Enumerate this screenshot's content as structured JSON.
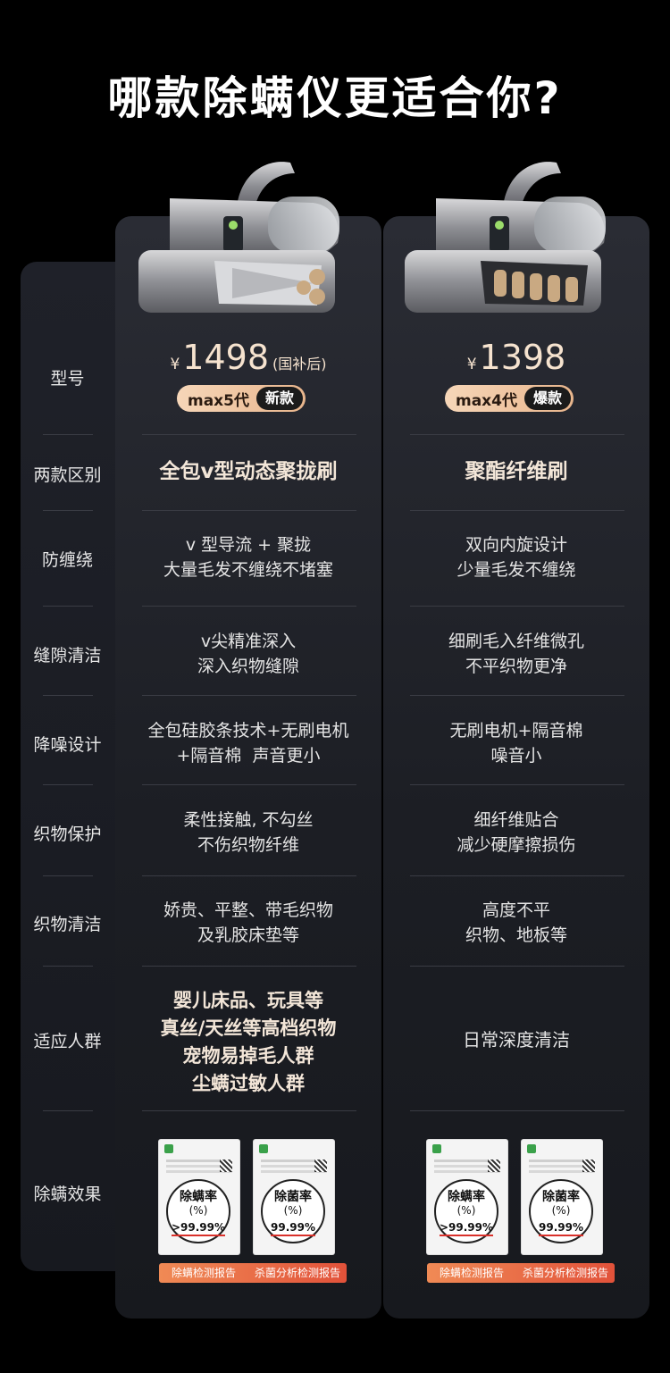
{
  "title": "哪款除螨仪更适合你?",
  "rows": [
    "型号",
    "两款区别",
    "防缠绕",
    "缝隙清洁",
    "降噪设计",
    "织物保护",
    "织物清洁",
    "适应人群",
    "除螨效果"
  ],
  "products": [
    {
      "price_symbol": "¥",
      "price": "1498",
      "price_note": "(国补后)",
      "model": "max5代",
      "tag": "新款",
      "diff": "全包v型动态聚拢刷",
      "anti_tangle": [
        "v 型导流 + 聚拢",
        "大量毛发不缠绕不堵塞"
      ],
      "gap_clean": [
        "v尖精准深入",
        "深入织物缝隙"
      ],
      "noise": [
        "全包硅胶条技术+无刷电机",
        "+隔音棉  声音更小"
      ],
      "fabric_protect": [
        "柔性接触, 不勾丝",
        "不伤织物纤维"
      ],
      "fabric_clean": [
        "娇贵、平整、带毛织物",
        "及乳胶床垫等"
      ],
      "audience": [
        "婴儿床品、玩具等",
        "真丝/天丝等高档织物",
        "宠物易掉毛人群",
        "尘螨过敏人群"
      ],
      "reports": [
        {
          "title": "除螨率",
          "unit": "(%)",
          "value": ">99.99%",
          "label": "除螨检测报告"
        },
        {
          "title": "除菌率",
          "unit": "(%)",
          "value": "99.99%",
          "label": "杀菌分析检测报告"
        }
      ]
    },
    {
      "price_symbol": "¥",
      "price": "1398",
      "price_note": "",
      "model": "max4代",
      "tag": "爆款",
      "diff": "聚酯纤维刷",
      "anti_tangle": [
        "双向内旋设计",
        "少量毛发不缠绕"
      ],
      "gap_clean": [
        "细刷毛入纤维微孔",
        "不平织物更净"
      ],
      "noise": [
        "无刷电机+隔音棉",
        "噪音小"
      ],
      "fabric_protect": [
        "细纤维贴合",
        "减少硬摩擦损伤"
      ],
      "fabric_clean": [
        "高度不平",
        "织物、地板等"
      ],
      "audience": [
        "日常深度清洁"
      ],
      "reports": [
        {
          "title": "除螨率",
          "unit": "(%)",
          "value": ">99.99%",
          "label": "除螨检测报告"
        },
        {
          "title": "除菌率",
          "unit": "(%)",
          "value": "99.99%",
          "label": "杀菌分析检测报告"
        }
      ]
    }
  ],
  "colors": {
    "accent": "#e8b58c",
    "card_bg": "#1f2129",
    "page_bg": "#000000",
    "report_bar": "#e2523a"
  }
}
